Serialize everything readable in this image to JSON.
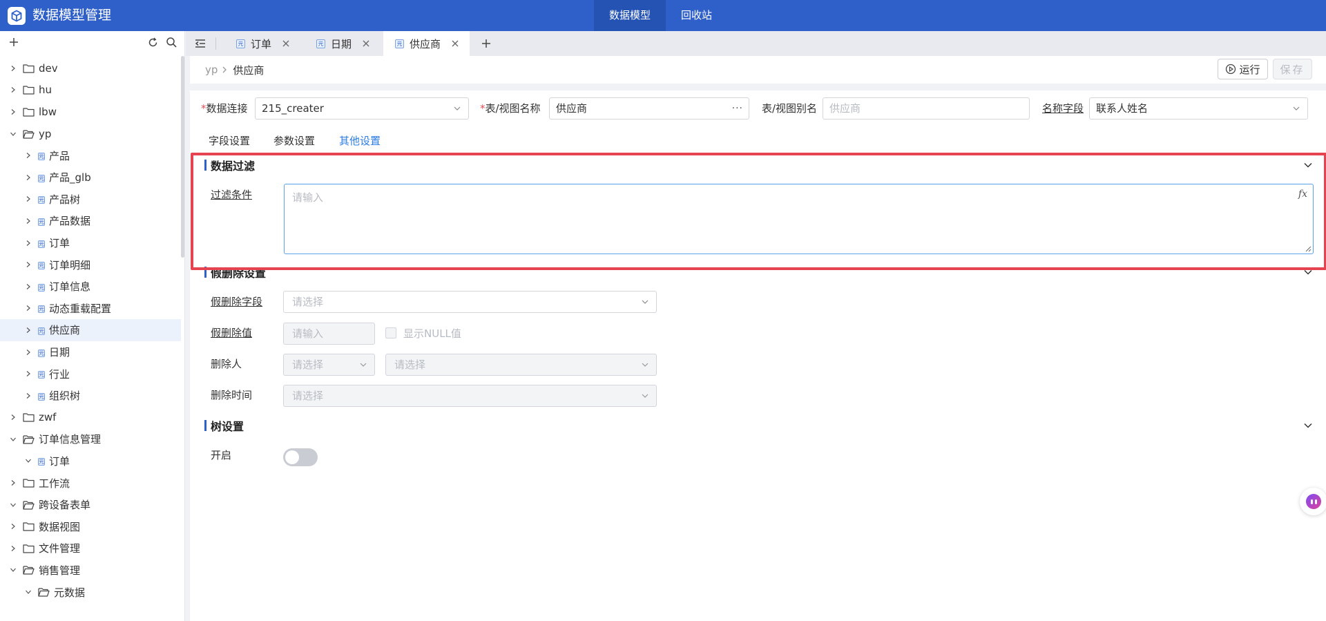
{
  "app": {
    "title": "数据模型管理"
  },
  "topnav": [
    {
      "label": "数据模型",
      "active": true
    },
    {
      "label": "回收站",
      "active": false
    }
  ],
  "tree": [
    {
      "label": "dev",
      "level": 0,
      "type": "folder",
      "expanded": false
    },
    {
      "label": "hu",
      "level": 0,
      "type": "folder",
      "expanded": false
    },
    {
      "label": "lbw",
      "level": 0,
      "type": "folder",
      "expanded": false
    },
    {
      "label": "yp",
      "level": 0,
      "type": "folder",
      "expanded": true
    },
    {
      "label": "产品",
      "level": 1,
      "type": "table",
      "expanded": false
    },
    {
      "label": "产品_glb",
      "level": 1,
      "type": "table",
      "expanded": false
    },
    {
      "label": "产品树",
      "level": 1,
      "type": "table",
      "expanded": false
    },
    {
      "label": "产品数据",
      "level": 1,
      "type": "table",
      "expanded": false
    },
    {
      "label": "订单",
      "level": 1,
      "type": "table",
      "expanded": false
    },
    {
      "label": "订单明细",
      "level": 1,
      "type": "table",
      "expanded": false
    },
    {
      "label": "订单信息",
      "level": 1,
      "type": "table",
      "expanded": false
    },
    {
      "label": "动态重载配置",
      "level": 1,
      "type": "table",
      "expanded": false
    },
    {
      "label": "供应商",
      "level": 1,
      "type": "table",
      "expanded": false,
      "selected": true
    },
    {
      "label": "日期",
      "level": 1,
      "type": "table",
      "expanded": false
    },
    {
      "label": "行业",
      "level": 1,
      "type": "table",
      "expanded": false
    },
    {
      "label": "组织树",
      "level": 1,
      "type": "table",
      "expanded": false
    },
    {
      "label": "zwf",
      "level": 0,
      "type": "folder",
      "expanded": false
    },
    {
      "label": "订单信息管理",
      "level": 0,
      "type": "folder",
      "expanded": true
    },
    {
      "label": "订单",
      "level": 1,
      "type": "table",
      "expanded": true
    },
    {
      "label": "工作流",
      "level": 0,
      "type": "folder",
      "expanded": false
    },
    {
      "label": "跨设备表单",
      "level": 0,
      "type": "folder",
      "expanded": true
    },
    {
      "label": "数据视图",
      "level": 0,
      "type": "folder",
      "expanded": false
    },
    {
      "label": "文件管理",
      "level": 0,
      "type": "folder",
      "expanded": false
    },
    {
      "label": "销售管理",
      "level": 0,
      "type": "folder",
      "expanded": true
    },
    {
      "label": "元数据",
      "level": 1,
      "type": "folder",
      "expanded": true
    }
  ],
  "tabs": [
    {
      "label": "订单",
      "active": false
    },
    {
      "label": "日期",
      "active": false
    },
    {
      "label": "供应商",
      "active": true
    }
  ],
  "breadcrumb": {
    "root": "yp",
    "current": "供应商"
  },
  "toolbar": {
    "run_label": "运行",
    "save_label": "保存"
  },
  "form": {
    "connection_label": "数据连接",
    "connection_value": "215_creater",
    "table_label": "表/视图名称",
    "table_value": "供应商",
    "table_more": "···",
    "alias_label": "表/视图别名",
    "alias_placeholder": "供应商",
    "name_field_label": "名称字段",
    "name_field_value": "联系人姓名"
  },
  "subtabs": [
    {
      "label": "字段设置",
      "active": false
    },
    {
      "label": "参数设置",
      "active": false
    },
    {
      "label": "其他设置",
      "active": true
    }
  ],
  "filter": {
    "title": "数据过滤",
    "condition_label": "过滤条件",
    "condition_placeholder": "请输入",
    "fx_label": "fx"
  },
  "soft_delete": {
    "title": "假删除设置",
    "field_label": "假删除字段",
    "field_placeholder": "请选择",
    "value_label": "假删除值",
    "value_placeholder": "请输入",
    "show_null_label": "显示NULL值",
    "deleter_label": "删除人",
    "deleter_placeholder_1": "请选择",
    "deleter_placeholder_2": "请选择",
    "time_label": "删除时间",
    "time_placeholder": "请选择"
  },
  "tree_settings": {
    "title": "树设置",
    "enable_label": "开启",
    "enabled": false
  },
  "colors": {
    "brand": "#2f60c9",
    "active_link": "#2a7be4",
    "highlight": "#e5434f",
    "required": "#e34d59"
  }
}
